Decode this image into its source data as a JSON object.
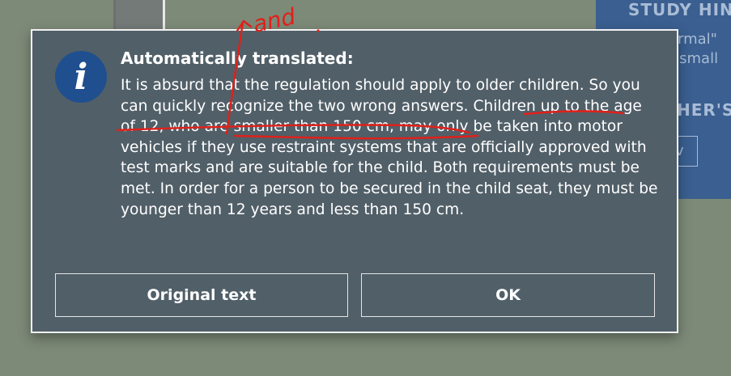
{
  "background": {
    "panel_title": "STUDY HINT",
    "panel_line_1": "ormal\"",
    "panel_line_2": "r small",
    "panel_heading": "HER'S",
    "panel_button": "v"
  },
  "dialog": {
    "title": "Automatically translated:",
    "body": "It is absurd that the regulation should apply to older children. So you can quickly recognize the two wrong answers. Children up to the age of 12, who are smaller than 150 cm, may only be taken into motor vehicles if they use restraint systems that are officially approved with test marks and are suitable for the child. Both requirements must be met. In order for a person to be secured in the child seat, they must be younger than 12 years and less than 150 cm.",
    "info_icon_letter": "i",
    "buttons": {
      "original_text": "Original text",
      "ok": "OK"
    }
  },
  "annotation": {
    "handwritten_text": "and",
    "color": "#e0201a"
  },
  "colors": {
    "dialog_bg": "#515f68",
    "page_bg": "#7d8a78",
    "panel_bg": "#3a5f90",
    "info_badge": "#1f4f8f"
  }
}
